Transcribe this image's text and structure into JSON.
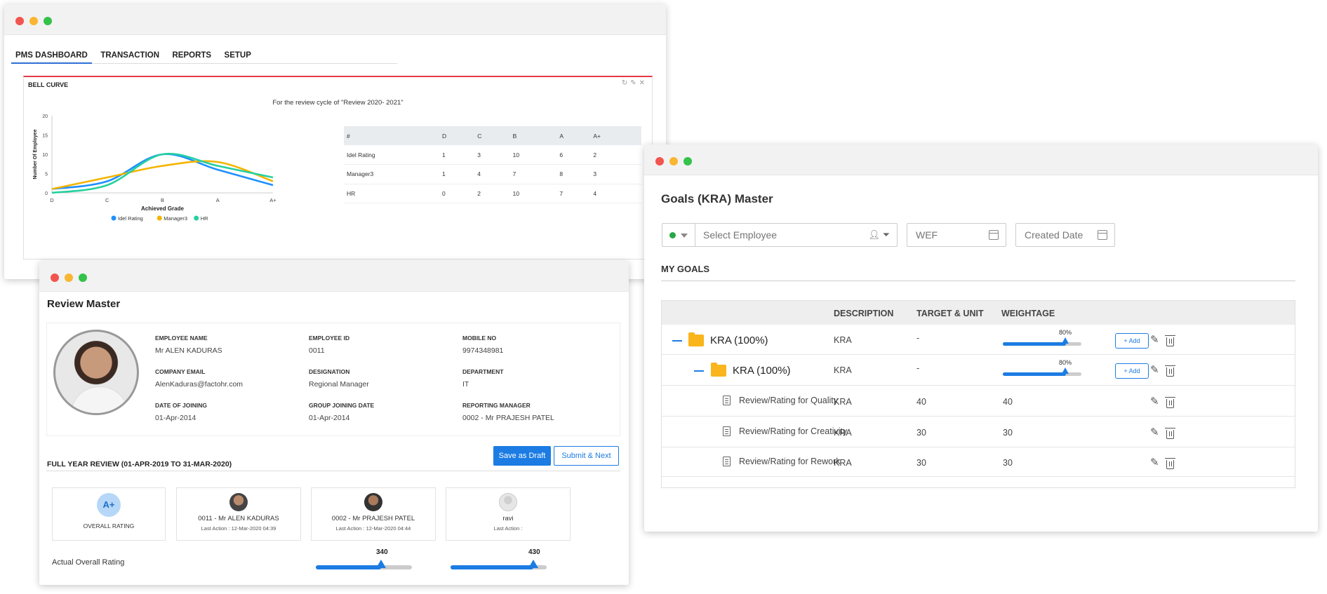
{
  "pms": {
    "tabs": [
      "PMS DASHBOARD",
      "TRANSACTION",
      "REPORTS",
      "SETUP"
    ],
    "panel_title": "BELL CURVE",
    "subtitle": "For the review cycle of \"Review 2020- 2021\"",
    "table": {
      "headers": [
        "#",
        "D",
        "C",
        "B",
        "A",
        "A+"
      ],
      "rows": [
        [
          "Idel Rating",
          "1",
          "3",
          "10",
          "6",
          "2"
        ],
        [
          "Manager3",
          "1",
          "4",
          "7",
          "8",
          "3"
        ],
        [
          "HR",
          "0",
          "2",
          "10",
          "7",
          "4"
        ]
      ]
    }
  },
  "chart_data": {
    "type": "line",
    "title": "",
    "xlabel": "Achieved Grade",
    "ylabel": "Number Of Employee",
    "categories": [
      "D",
      "C",
      "B",
      "A",
      "A+"
    ],
    "ylim": [
      0,
      20
    ],
    "yticks": [
      "0",
      "5",
      "10",
      "15",
      "20"
    ],
    "legend_position": "bottom",
    "series": [
      {
        "name": "Idel Rating",
        "color": "#1e90ff",
        "values": [
          1,
          3,
          10,
          6,
          2
        ]
      },
      {
        "name": "Manager3",
        "color": "#f4b400",
        "values": [
          1,
          4,
          7,
          8,
          3
        ]
      },
      {
        "name": "HR",
        "color": "#26d0a0",
        "values": [
          0,
          2,
          10,
          7,
          4
        ]
      }
    ]
  },
  "review": {
    "title": "Review Master",
    "fields": [
      {
        "label": "EMPLOYEE NAME",
        "value": "Mr ALEN KADURAS"
      },
      {
        "label": "EMPLOYEE ID",
        "value": "0011"
      },
      {
        "label": "MOBILE NO",
        "value": "9974348981"
      },
      {
        "label": "COMPANY EMAIL",
        "value": "AlenKaduras@factohr.com"
      },
      {
        "label": "DESIGNATION",
        "value": "Regional Manager"
      },
      {
        "label": "DEPARTMENT",
        "value": "IT"
      },
      {
        "label": "DATE OF JOINING",
        "value": "01-Apr-2014"
      },
      {
        "label": "GROUP JOINING DATE",
        "value": "01-Apr-2014"
      },
      {
        "label": "REPORTING MANAGER",
        "value": "0002 - Mr PRAJESH PATEL"
      }
    ],
    "section_title": "FULL YEAR REVIEW (01-APR-2019 TO 31-MAR-2020)",
    "save_draft_label": "Save as Draft",
    "submit_next_label": "Submit & Next",
    "overall_badge": "A+",
    "overall_label": "OVERALL RATING",
    "reviewers": [
      {
        "name": "0011 - Mr ALEN KADURAS",
        "action": "Last Action : 12-Mar-2020 04:39"
      },
      {
        "name": "0002 - Mr PRAJESH PATEL",
        "action": "Last Action : 12-Mar-2020 04:44"
      },
      {
        "name": "ravi",
        "action": "Last Action :"
      }
    ],
    "actual_rating_label": "Actual Overall Rating",
    "ratings": [
      {
        "value": "340",
        "fraction": 0.68
      },
      {
        "value": "430",
        "fraction": 0.86
      }
    ]
  },
  "goals": {
    "title": "Goals (KRA) Master",
    "employee_placeholder": "Select Employee",
    "wef_placeholder": "WEF",
    "created_placeholder": "Created Date",
    "section": "MY GOALS",
    "headers": {
      "description": "DESCRIPTION",
      "target": "TARGET & UNIT",
      "weightage": "WEIGHTAGE"
    },
    "add_label": "+ Add",
    "rows": [
      {
        "name": "KRA (100%)",
        "description": "KRA",
        "target": "-",
        "weightage_pct": "80%",
        "weightage_fraction": 0.8
      },
      {
        "name": "KRA (100%)",
        "description": "KRA",
        "target": "-",
        "weightage_pct": "80%",
        "weightage_fraction": 0.8
      },
      {
        "name": "Review/Rating for Quality",
        "description": "KRA",
        "target": "40",
        "weightage": "40"
      },
      {
        "name": "Review/Rating for Creativity",
        "description": "KRA",
        "target": "30",
        "weightage": "30"
      },
      {
        "name": "Review/Rating for Rework",
        "description": "KRA",
        "target": "30",
        "weightage": "30"
      }
    ]
  }
}
